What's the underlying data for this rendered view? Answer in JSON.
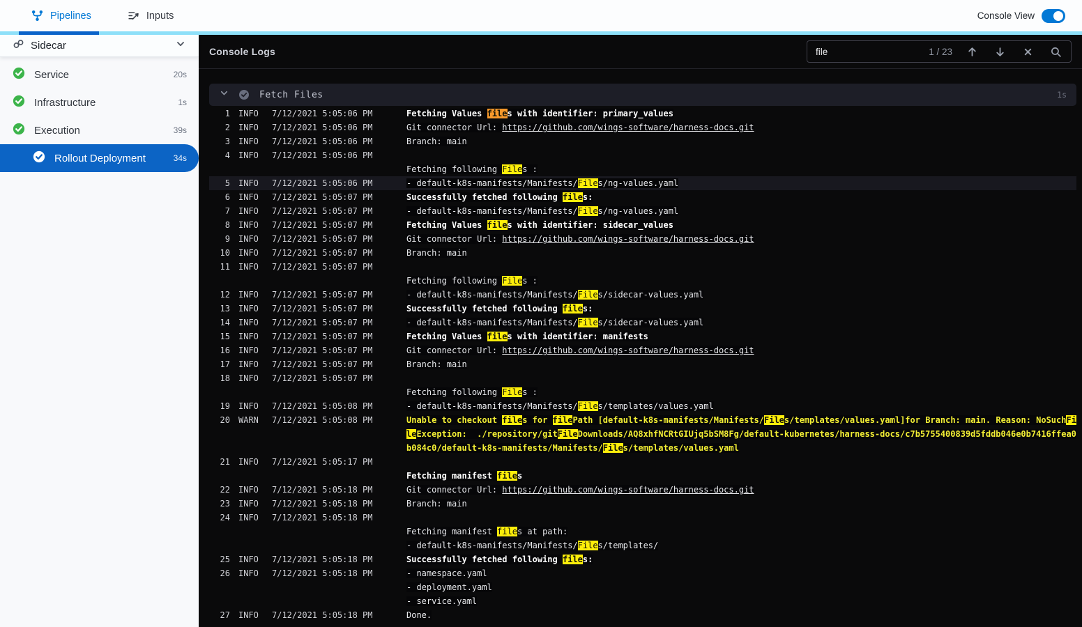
{
  "colors": {
    "primary_blue": "#0278d5",
    "active_underline": "#0a63c9",
    "strip_light_blue": "#8ee0f9",
    "selected_step_blue": "#0c64c5",
    "success_green": "#3cb44a",
    "match_yellow": "#fdee0a",
    "current_match_orange": "#f8992b",
    "warn_text_yellow": "#f3ef35"
  },
  "header": {
    "tabs": [
      {
        "label": "Pipelines",
        "active": true
      },
      {
        "label": "Inputs",
        "active": false
      }
    ],
    "console_view_label": "Console View",
    "console_view_on": true
  },
  "sidebar": {
    "title": "Sidecar",
    "items": [
      {
        "label": "Service",
        "duration": "20s",
        "status": "success",
        "selected": false
      },
      {
        "label": "Infrastructure",
        "duration": "1s",
        "status": "success",
        "selected": false
      },
      {
        "label": "Execution",
        "duration": "39s",
        "status": "success",
        "selected": false
      },
      {
        "label": "Rollout Deployment",
        "duration": "34s",
        "status": "success",
        "selected": true
      }
    ]
  },
  "console": {
    "title": "Console Logs",
    "search": {
      "value": "file",
      "counter": "1 / 23"
    },
    "section": {
      "title": "Fetch Files",
      "duration": "1s"
    }
  },
  "logs": [
    {
      "n": "1",
      "level": "INFO",
      "time": "7/12/2021 5:05:06 PM",
      "style": "bold",
      "parts": [
        [
          "Fetching Values ",
          "text"
        ],
        [
          "file",
          "current"
        ],
        [
          "s with identifier: primary_values",
          "text"
        ]
      ]
    },
    {
      "n": "2",
      "level": "INFO",
      "time": "7/12/2021 5:05:06 PM",
      "style": "plain",
      "parts": [
        [
          "Git connector Url: ",
          "text"
        ],
        [
          "https://github.com/wings-software/harness-docs.git",
          "link"
        ]
      ]
    },
    {
      "n": "3",
      "level": "INFO",
      "time": "7/12/2021 5:05:06 PM",
      "style": "plain",
      "parts": [
        [
          "Branch: main",
          "text"
        ]
      ]
    },
    {
      "n": "4",
      "level": "INFO",
      "time": "7/12/2021 5:05:06 PM",
      "style": "plain",
      "parts": []
    },
    {
      "n": "",
      "level": "",
      "time": "",
      "style": "plain",
      "parts": [
        [
          "Fetching following ",
          "text"
        ],
        [
          "File",
          "match"
        ],
        [
          "s :",
          "text"
        ]
      ]
    },
    {
      "n": "5",
      "level": "INFO",
      "time": "7/12/2021 5:05:06 PM",
      "style": "plain",
      "highlight_row": true,
      "parts": [
        [
          "- default-k8s-manifests/Manifests/",
          "text"
        ],
        [
          "File",
          "match"
        ],
        [
          "s/ng-values.yaml",
          "text"
        ]
      ]
    },
    {
      "n": "6",
      "level": "INFO",
      "time": "7/12/2021 5:05:07 PM",
      "style": "bold",
      "parts": [
        [
          "Successfully fetched following ",
          "text"
        ],
        [
          "file",
          "match"
        ],
        [
          "s:",
          "text"
        ]
      ]
    },
    {
      "n": "7",
      "level": "INFO",
      "time": "7/12/2021 5:05:07 PM",
      "style": "plain",
      "parts": [
        [
          "- default-k8s-manifests/Manifests/",
          "text"
        ],
        [
          "File",
          "match"
        ],
        [
          "s/ng-values.yaml",
          "text"
        ]
      ]
    },
    {
      "n": "8",
      "level": "INFO",
      "time": "7/12/2021 5:05:07 PM",
      "style": "bold",
      "parts": [
        [
          "Fetching Values ",
          "text"
        ],
        [
          "file",
          "match"
        ],
        [
          "s with identifier: sidecar_values",
          "text"
        ]
      ]
    },
    {
      "n": "9",
      "level": "INFO",
      "time": "7/12/2021 5:05:07 PM",
      "style": "plain",
      "parts": [
        [
          "Git connector Url: ",
          "text"
        ],
        [
          "https://github.com/wings-software/harness-docs.git",
          "link"
        ]
      ]
    },
    {
      "n": "10",
      "level": "INFO",
      "time": "7/12/2021 5:05:07 PM",
      "style": "plain",
      "parts": [
        [
          "Branch: main",
          "text"
        ]
      ]
    },
    {
      "n": "11",
      "level": "INFO",
      "time": "7/12/2021 5:05:07 PM",
      "style": "plain",
      "parts": []
    },
    {
      "n": "",
      "level": "",
      "time": "",
      "style": "plain",
      "parts": [
        [
          "Fetching following ",
          "text"
        ],
        [
          "File",
          "match"
        ],
        [
          "s :",
          "text"
        ]
      ]
    },
    {
      "n": "12",
      "level": "INFO",
      "time": "7/12/2021 5:05:07 PM",
      "style": "plain",
      "parts": [
        [
          "- default-k8s-manifests/Manifests/",
          "text"
        ],
        [
          "File",
          "match"
        ],
        [
          "s/sidecar-values.yaml",
          "text"
        ]
      ]
    },
    {
      "n": "13",
      "level": "INFO",
      "time": "7/12/2021 5:05:07 PM",
      "style": "bold",
      "parts": [
        [
          "Successfully fetched following ",
          "text"
        ],
        [
          "file",
          "match"
        ],
        [
          "s:",
          "text"
        ]
      ]
    },
    {
      "n": "14",
      "level": "INFO",
      "time": "7/12/2021 5:05:07 PM",
      "style": "plain",
      "parts": [
        [
          "- default-k8s-manifests/Manifests/",
          "text"
        ],
        [
          "File",
          "match"
        ],
        [
          "s/sidecar-values.yaml",
          "text"
        ]
      ]
    },
    {
      "n": "15",
      "level": "INFO",
      "time": "7/12/2021 5:05:07 PM",
      "style": "bold",
      "parts": [
        [
          "Fetching Values ",
          "text"
        ],
        [
          "file",
          "match"
        ],
        [
          "s with identifier: manifests",
          "text"
        ]
      ]
    },
    {
      "n": "16",
      "level": "INFO",
      "time": "7/12/2021 5:05:07 PM",
      "style": "plain",
      "parts": [
        [
          "Git connector Url: ",
          "text"
        ],
        [
          "https://github.com/wings-software/harness-docs.git",
          "link"
        ]
      ]
    },
    {
      "n": "17",
      "level": "INFO",
      "time": "7/12/2021 5:05:07 PM",
      "style": "plain",
      "parts": [
        [
          "Branch: main",
          "text"
        ]
      ]
    },
    {
      "n": "18",
      "level": "INFO",
      "time": "7/12/2021 5:05:07 PM",
      "style": "plain",
      "parts": []
    },
    {
      "n": "",
      "level": "",
      "time": "",
      "style": "plain",
      "parts": [
        [
          "Fetching following ",
          "text"
        ],
        [
          "File",
          "match"
        ],
        [
          "s :",
          "text"
        ]
      ]
    },
    {
      "n": "19",
      "level": "INFO",
      "time": "7/12/2021 5:05:08 PM",
      "style": "plain",
      "parts": [
        [
          "- default-k8s-manifests/Manifests/",
          "text"
        ],
        [
          "File",
          "match"
        ],
        [
          "s/templates/values.yaml",
          "text"
        ]
      ]
    },
    {
      "n": "20",
      "level": "WARN",
      "time": "7/12/2021 5:05:08 PM",
      "style": "warn",
      "parts": [
        [
          "Unable to checkout ",
          "text"
        ],
        [
          "file",
          "match"
        ],
        [
          "s for ",
          "text"
        ],
        [
          "file",
          "match"
        ],
        [
          "Path [default-k8s-manifests/Manifests/",
          "text"
        ],
        [
          "File",
          "match"
        ],
        [
          "s/templates/values.yaml]for Branch: main. Reason: NoSuch",
          "text"
        ],
        [
          "File",
          "match"
        ],
        [
          "Exception:  ./repository/git",
          "text"
        ],
        [
          "File",
          "match"
        ],
        [
          "Downloads/AQ8xhfNCRtGIUjq5bSM8Fg/default-kubernetes/harness-docs/c7b5755400839d5fddb046e0b7416ffea0b084c0/default-k8s-manifests/Manifests/",
          "text"
        ],
        [
          "File",
          "match"
        ],
        [
          "s/templates/values.yaml",
          "text"
        ]
      ]
    },
    {
      "n": "21",
      "level": "INFO",
      "time": "7/12/2021 5:05:17 PM",
      "style": "plain",
      "parts": []
    },
    {
      "n": "",
      "level": "",
      "time": "",
      "style": "bold",
      "parts": [
        [
          "Fetching manifest ",
          "text"
        ],
        [
          "file",
          "match"
        ],
        [
          "s",
          "text"
        ]
      ]
    },
    {
      "n": "22",
      "level": "INFO",
      "time": "7/12/2021 5:05:18 PM",
      "style": "plain",
      "parts": [
        [
          "Git connector Url: ",
          "text"
        ],
        [
          "https://github.com/wings-software/harness-docs.git",
          "link"
        ]
      ]
    },
    {
      "n": "23",
      "level": "INFO",
      "time": "7/12/2021 5:05:18 PM",
      "style": "plain",
      "parts": [
        [
          "Branch: main",
          "text"
        ]
      ]
    },
    {
      "n": "24",
      "level": "INFO",
      "time": "7/12/2021 5:05:18 PM",
      "style": "plain",
      "parts": []
    },
    {
      "n": "",
      "level": "",
      "time": "",
      "style": "plain",
      "parts": [
        [
          "Fetching manifest ",
          "text"
        ],
        [
          "file",
          "match"
        ],
        [
          "s at path:",
          "text"
        ]
      ]
    },
    {
      "n": "",
      "level": "",
      "time": "",
      "style": "plain",
      "parts": [
        [
          "- default-k8s-manifests/Manifests/",
          "text"
        ],
        [
          "File",
          "match"
        ],
        [
          "s/templates/",
          "text"
        ]
      ]
    },
    {
      "n": "25",
      "level": "INFO",
      "time": "7/12/2021 5:05:18 PM",
      "style": "bold",
      "parts": [
        [
          "Successfully fetched following ",
          "text"
        ],
        [
          "file",
          "match"
        ],
        [
          "s:",
          "text"
        ]
      ]
    },
    {
      "n": "26",
      "level": "INFO",
      "time": "7/12/2021 5:05:18 PM",
      "style": "plain",
      "parts": [
        [
          "- namespace.yaml",
          "text"
        ]
      ]
    },
    {
      "n": "",
      "level": "",
      "time": "",
      "style": "plain",
      "parts": [
        [
          "- deployment.yaml",
          "text"
        ]
      ]
    },
    {
      "n": "",
      "level": "",
      "time": "",
      "style": "plain",
      "parts": [
        [
          "- service.yaml",
          "text"
        ]
      ]
    },
    {
      "n": "27",
      "level": "INFO",
      "time": "7/12/2021 5:05:18 PM",
      "style": "plain",
      "parts": [
        [
          "Done.",
          "text"
        ]
      ]
    }
  ]
}
